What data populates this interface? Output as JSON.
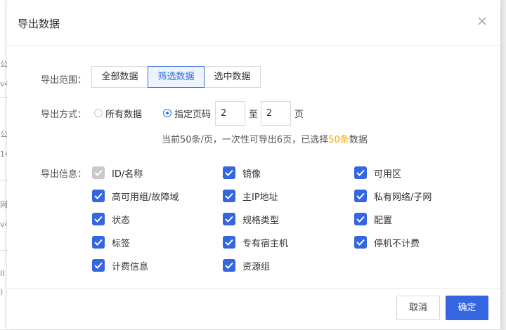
{
  "background": {
    "peek_text": [
      "公司",
      "v4",
      "公",
      "14",
      "网",
      "v4",
      "II",
      ")"
    ]
  },
  "dialog": {
    "title": "导出数据",
    "close_icon": "close-icon"
  },
  "export_range": {
    "label": "导出范围：",
    "options": [
      {
        "label": "全部数据",
        "active": false
      },
      {
        "label": "筛选数据",
        "active": true
      },
      {
        "label": "选中数据",
        "active": false
      }
    ]
  },
  "export_mode": {
    "label": "导出方式：",
    "all_label": "所有数据",
    "pages_label": "指定页码",
    "selected": "pages",
    "from_page": "2",
    "to_label": "至",
    "to_page": "2",
    "page_unit": "页"
  },
  "summary": {
    "prefix": "当前50条/页，一次性可导出6页，已选择",
    "highlight": "50条",
    "suffix": "数据",
    "highlight_color": "#f2a400"
  },
  "export_info": {
    "label": "导出信息：",
    "fields": [
      {
        "label": "ID/名称",
        "checked": true,
        "disabled": true
      },
      {
        "label": "镜像",
        "checked": true,
        "disabled": false
      },
      {
        "label": "可用区",
        "checked": true,
        "disabled": false
      },
      {
        "label": "高可用组/故障域",
        "checked": true,
        "disabled": false
      },
      {
        "label": "主IP地址",
        "checked": true,
        "disabled": false
      },
      {
        "label": "私有网络/子网",
        "checked": true,
        "disabled": false
      },
      {
        "label": "状态",
        "checked": true,
        "disabled": false
      },
      {
        "label": "规格类型",
        "checked": true,
        "disabled": false
      },
      {
        "label": "配置",
        "checked": true,
        "disabled": false
      },
      {
        "label": "标签",
        "checked": true,
        "disabled": false
      },
      {
        "label": "专有宿主机",
        "checked": true,
        "disabled": false
      },
      {
        "label": "停机不计费",
        "checked": true,
        "disabled": false
      },
      {
        "label": "计费信息",
        "checked": true,
        "disabled": false
      },
      {
        "label": "资源组",
        "checked": true,
        "disabled": false
      }
    ]
  },
  "footer": {
    "cancel_label": "取消",
    "ok_label": "确定"
  },
  "colors": {
    "accent": "#3366e0",
    "disabled": "#c9c9c9"
  }
}
